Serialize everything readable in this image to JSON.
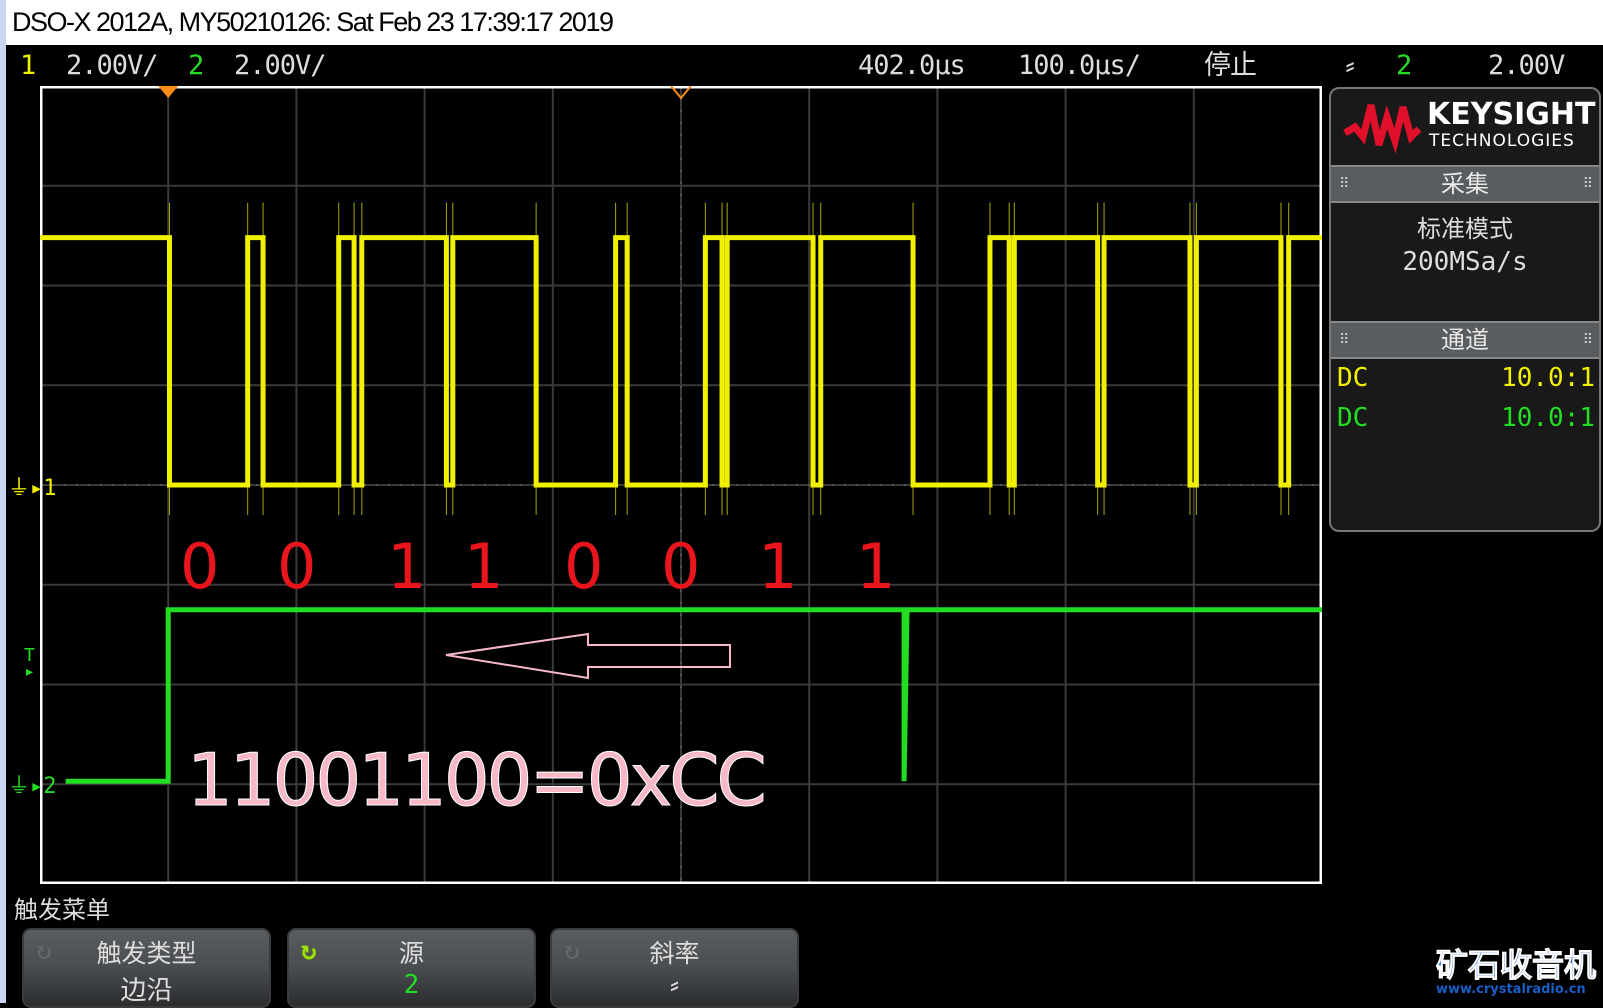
{
  "title": "DSO-X 2012A, MY50210126: Sat Feb 23 17:39:17 2019",
  "status": {
    "ch1_num": "1",
    "ch1_scale": "2.00V/",
    "ch2_num": "2",
    "ch2_scale": "2.00V/",
    "delay": "402.0µs",
    "timebase": "100.0µs/",
    "run_state": "停止",
    "trigger_slope_icon": "rising-edge-icon",
    "trigger_source": "2",
    "trigger_level": "2.00V"
  },
  "colors": {
    "ch1": "#f0f000",
    "ch2": "#22dd22",
    "trigger_marker": "#ff8c1a",
    "annotation_red": "#e8161c",
    "annotation_pink": "#f7b8c8"
  },
  "waveforms": {
    "divisions": {
      "x": 10,
      "y": 8
    },
    "ch1": {
      "ground_div_from_top": 4.0,
      "high_div_from_top": 1.52,
      "start_level": "high",
      "edges_div": [
        1.01,
        1.62,
        1.74,
        2.33,
        2.45,
        2.51,
        3.17,
        3.22,
        3.87,
        4.49,
        4.58,
        5.19,
        5.32,
        5.36,
        6.03,
        6.09,
        6.81,
        7.41,
        7.56,
        7.6,
        8.25,
        8.3,
        8.97,
        9.02,
        9.68,
        9.74
      ]
    },
    "ch2": {
      "ground_div_from_top": 6.97,
      "high_div_from_top": 5.25,
      "start_div": 0.2,
      "start_level": "low",
      "edges_div": [
        1.0
      ],
      "glitch_div": 6.74
    }
  },
  "markers": {
    "ch1_label": "1",
    "ch2_label": "2",
    "trigger_label": "T"
  },
  "annotations": {
    "bits": [
      "0",
      "0",
      "1",
      "1",
      "0",
      "0",
      "1",
      "1"
    ],
    "result": "11001100=0xCC"
  },
  "panel": {
    "brand": "KEYSIGHT",
    "brand_sub": "TECHNOLOGIES",
    "acq_title": "采集",
    "acq_mode": "标准模式",
    "sample_rate": "200MSa/s",
    "chan_title": "通道",
    "ch1_coupling": "DC",
    "ch1_probe": "10.0:1",
    "ch2_coupling": "DC",
    "ch2_probe": "10.0:1"
  },
  "menu": {
    "title": "触发菜单",
    "buttons": [
      {
        "label": "触发类型",
        "value": "边沿"
      },
      {
        "label": "源",
        "value": "2"
      },
      {
        "label": "斜率",
        "value": "rising-edge"
      }
    ]
  },
  "watermark": {
    "text": "矿石收音机",
    "url": "www.crystalradio.cn"
  }
}
